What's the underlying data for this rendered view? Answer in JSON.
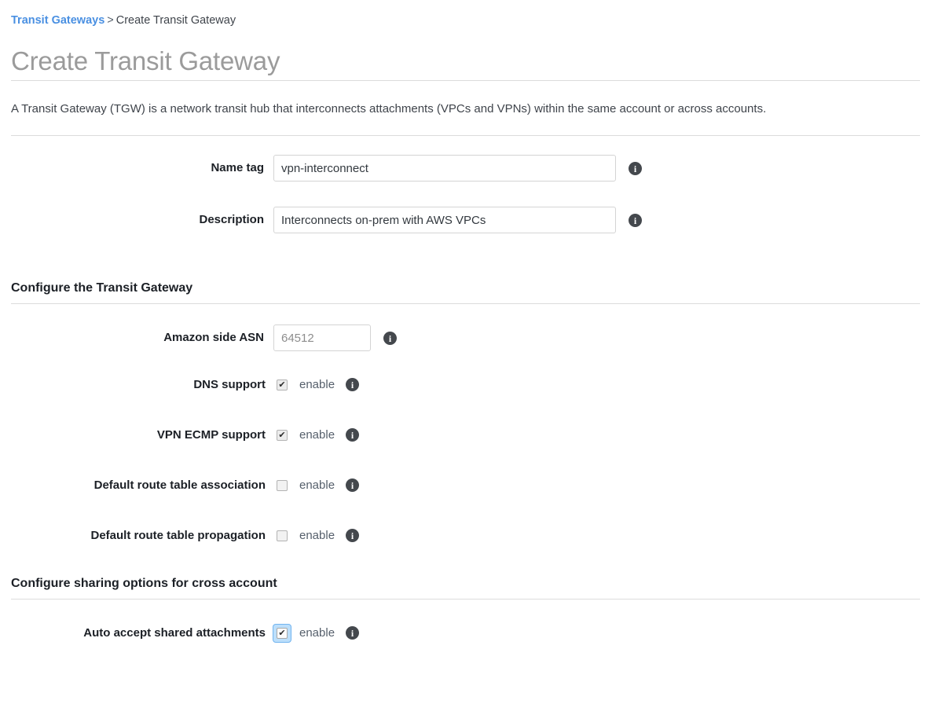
{
  "breadcrumb": {
    "link_label": "Transit Gateways",
    "separator": ">",
    "current": "Create Transit Gateway"
  },
  "page_title": "Create Transit Gateway",
  "intro_text": "A Transit Gateway (TGW) is a network transit hub that interconnects attachments (VPCs and VPNs) within the same account or across accounts.",
  "icons": {
    "info": "i",
    "checkmark": "✔"
  },
  "fields": {
    "name_tag": {
      "label": "Name tag",
      "value": "vpn-interconnect",
      "placeholder": ""
    },
    "description": {
      "label": "Description",
      "value": "Interconnects on-prem with AWS VPCs",
      "placeholder": ""
    },
    "asn": {
      "label": "Amazon side ASN",
      "value": "",
      "placeholder": "64512"
    }
  },
  "sections": {
    "configure_tgw": {
      "heading": "Configure the Transit Gateway",
      "options": [
        {
          "label": "DNS support",
          "enable_label": "enable",
          "checked": true,
          "focused": false
        },
        {
          "label": "VPN ECMP support",
          "enable_label": "enable",
          "checked": true,
          "focused": false
        },
        {
          "label": "Default route table association",
          "enable_label": "enable",
          "checked": false,
          "focused": false
        },
        {
          "label": "Default route table propagation",
          "enable_label": "enable",
          "checked": false,
          "focused": false
        }
      ]
    },
    "sharing": {
      "heading": "Configure sharing options for cross account",
      "options": [
        {
          "label": "Auto accept shared attachments",
          "enable_label": "enable",
          "checked": true,
          "focused": true
        }
      ]
    }
  },
  "colors": {
    "link_blue": "#4a90e2",
    "title_gray": "#9b9b9b",
    "heading_dark": "#1c2026",
    "focus_blue": "#bcdffb",
    "info_icon_bg": "#44484d"
  }
}
